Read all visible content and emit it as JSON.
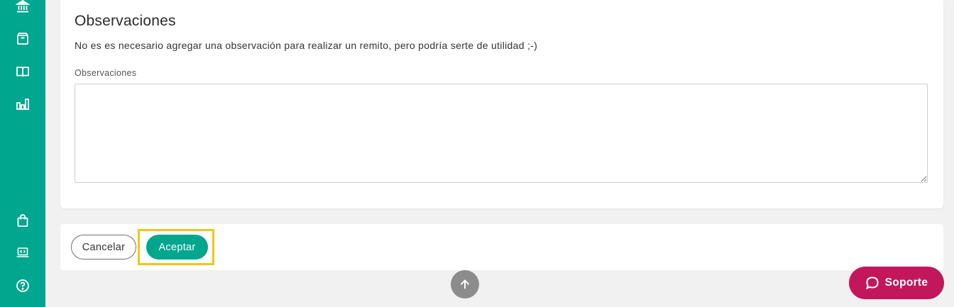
{
  "sidebar": {
    "icons": [
      "bank-icon",
      "box-icon",
      "book-icon",
      "bar-chart-icon",
      "shopping-bag-icon",
      "laptop-code-icon",
      "help-circle-icon"
    ]
  },
  "observations": {
    "title": "Observaciones",
    "description": "No es es necesario agregar una observación para realizar un remito, pero podría serte de utilidad ;-)",
    "field_label": "Observaciones",
    "field_value": ""
  },
  "actions": {
    "cancel_label": "Cancelar",
    "accept_label": "Aceptar"
  },
  "support": {
    "label": "Soporte"
  },
  "colors": {
    "brand": "#00a68d",
    "support": "#c2185b",
    "highlight": "#f5c518"
  }
}
